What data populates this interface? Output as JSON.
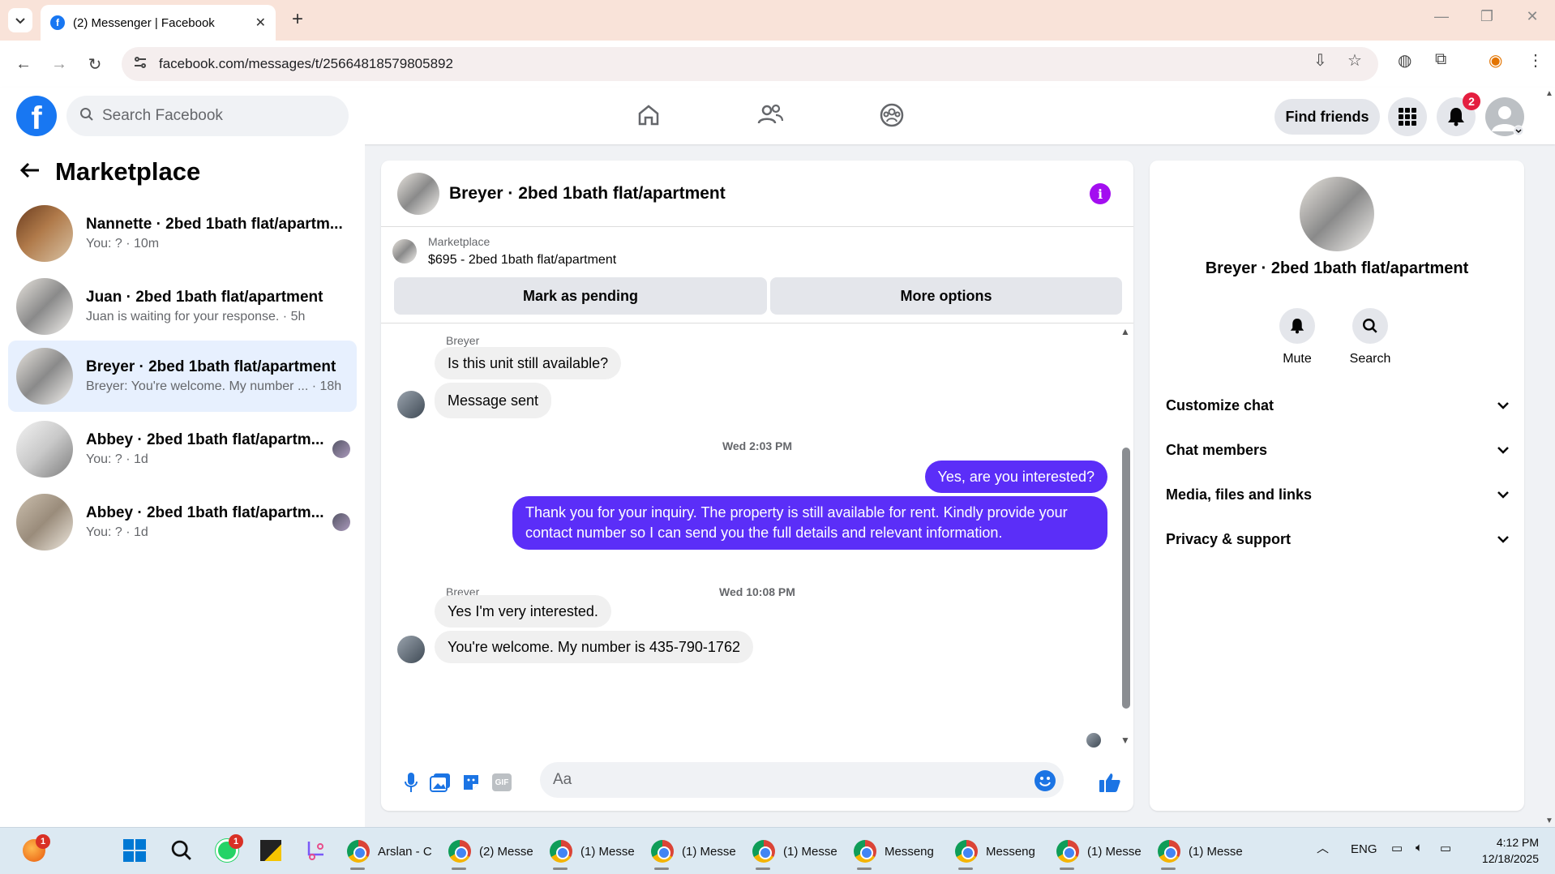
{
  "browser": {
    "tab_title": "(2) Messenger | Facebook",
    "url": "facebook.com/messages/t/25664818579805892"
  },
  "fb": {
    "search_placeholder": "Search Facebook",
    "find_friends": "Find friends",
    "notification_count": "2"
  },
  "left": {
    "title": "Marketplace",
    "conversations": [
      {
        "name": "Nannette · 2bed 1bath flat/apartm...",
        "sub": "You: ? · 10m"
      },
      {
        "name": "Juan · 2bed 1bath flat/apartment",
        "sub": "Juan is waiting for your response. · 5h"
      },
      {
        "name": "Breyer · 2bed 1bath flat/apartment",
        "sub": "Breyer: You're welcome. My number ... · 18h"
      },
      {
        "name": "Abbey · 2bed 1bath flat/apartm...",
        "sub": "You: ? · 1d"
      },
      {
        "name": "Abbey · 2bed 1bath flat/apartm...",
        "sub": "You: ? · 1d"
      }
    ]
  },
  "chat": {
    "title": "Breyer · 2bed 1bath flat/apartment",
    "listing_label": "Marketplace",
    "listing_price": "$695 - 2bed 1bath flat/apartment",
    "mark_pending": "Mark as pending",
    "more_options": "More options",
    "messages": {
      "sender1": "Breyer",
      "in1": "Is this unit still available?",
      "in2": "Message sent",
      "time1": "Wed 2:03 PM",
      "out1": "Yes, are you interested?",
      "out2": "Thank you for your inquiry. The property is still available for rent. Kindly provide your contact number so I can send you the full details and relevant information.",
      "time2": "Wed 10:08 PM",
      "sender2": "Breyer",
      "in3": "Yes I'm very interested.",
      "in4": "You're welcome. My number is 435-790-1762"
    },
    "composer_placeholder": "Aa",
    "gif_label": "GIF"
  },
  "right": {
    "name": "Breyer · 2bed 1bath flat/apartment",
    "mute": "Mute",
    "search": "Search",
    "sections": [
      "Customize chat",
      "Chat members",
      "Media, files and links",
      "Privacy & support"
    ]
  },
  "taskbar": {
    "apps": [
      "Arslan - C",
      "(2) Messe",
      "(1) Messe",
      "(1) Messe",
      "(1) Messe",
      "Messeng",
      "Messeng",
      "(1) Messe",
      "(1) Messe"
    ],
    "orange_badge": "1",
    "whatsapp_badge": "1",
    "lang": "ENG",
    "time": "4:12 PM",
    "date": "12/18/2025"
  },
  "colors": {
    "fb_blue": "#1877f2",
    "outgoing_bubble": "#5b2ef8",
    "info_purple": "#a30ef0",
    "active_conv": "#e7f0fe"
  },
  "icons": [
    "home-icon",
    "friends-icon",
    "groups-icon",
    "menu-grid-icon",
    "bell-icon",
    "account-icon",
    "mic-icon",
    "photo-icon",
    "sticker-icon",
    "gif-icon",
    "emoji-icon",
    "thumbs-up-icon",
    "search-icon",
    "chevron-down-icon"
  ]
}
